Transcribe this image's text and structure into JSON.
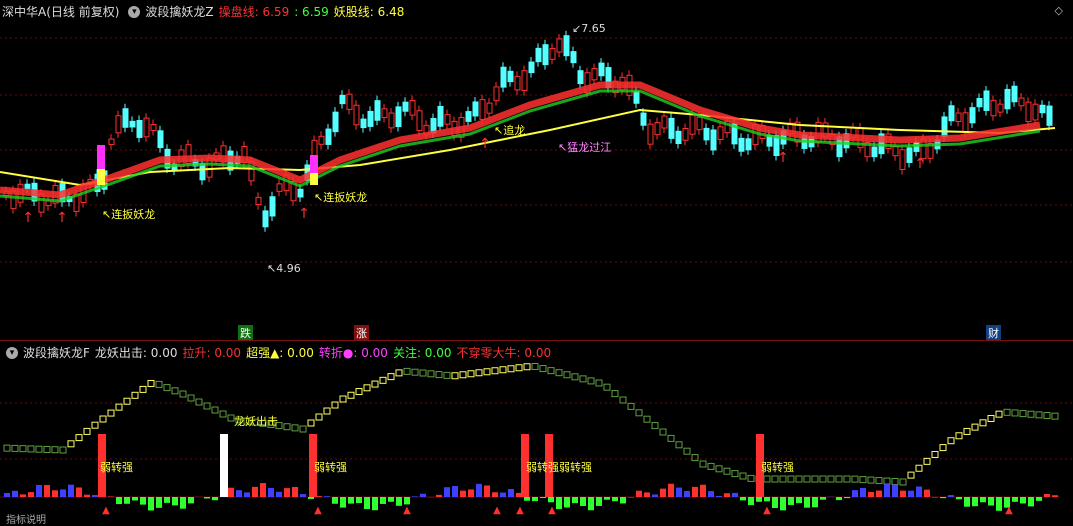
{
  "main": {
    "title": "深中华A(日线 前复权)",
    "indicator": "波段擒妖龙Z",
    "label1": "操盘线: 6.59",
    "label2": ": 6.59",
    "label3": "妖股线: 6.48",
    "corner_icon": "diamond-up-icon",
    "high_price": "7.65",
    "low_price": "4.96",
    "annotations": [
      "连扳妖龙",
      "连扳妖龙",
      "追龙",
      "猛龙过江"
    ],
    "markers": [
      "跌",
      "涨",
      "财"
    ]
  },
  "sub": {
    "indicator": "波段擒妖龙F",
    "items": [
      {
        "label": "龙妖出击: 0.00",
        "color": "#dddddd"
      },
      {
        "label": "拉升: 0.00",
        "color": "#ff3030"
      },
      {
        "label": "超强▲: 0.00",
        "color": "#ffff40"
      },
      {
        "label": "转折●: 0.00",
        "color": "#ff40ff"
      },
      {
        "label": "关注: 0.00",
        "color": "#40ff40"
      },
      {
        "label": "不穿零大牛: 0.00",
        "color": "#ff3030"
      }
    ],
    "annotations": [
      "弱转强",
      "弱转强",
      "弱转强",
      "弱转强",
      "弱转强",
      "龙妖出击"
    ],
    "bottom_text": "指标说明"
  },
  "colors": {
    "up": "#ff3030",
    "down": "#54ffff",
    "yellow": "#ffff40",
    "green": "#20d020",
    "magenta": "#ff30ff"
  }
}
